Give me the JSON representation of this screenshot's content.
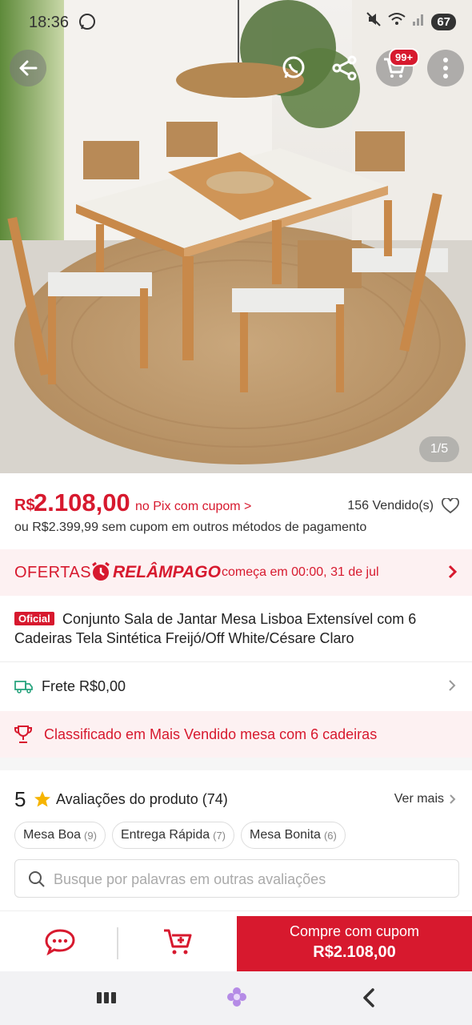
{
  "status_bar": {
    "time": "18:36",
    "battery": "67"
  },
  "header": {
    "cart_badge": "99+"
  },
  "gallery": {
    "counter": "1/5"
  },
  "price": {
    "currency": "R$",
    "value": "2.108,00",
    "pix_note": "no Pix com cupom >",
    "sold": "156 Vendido(s)",
    "alt_price": "ou R$2.399,99 sem cupom em outros métodos de pagamento"
  },
  "flash_sale": {
    "ofertas": "OFERTAS",
    "relampago": "RELÂMPAGO",
    "when": "começa em 00:00, 31 de jul"
  },
  "product": {
    "badge": "Oficial",
    "title": "Conjunto Sala de Jantar Mesa Lisboa Extensível com 6 Cadeiras Tela Sintética Freijó/Off White/Césare Claro"
  },
  "shipping": {
    "label": "Frete R$0,00"
  },
  "ranking": {
    "label": "Classificado em Mais Vendido mesa com 6 cadeiras"
  },
  "reviews": {
    "rating": "5",
    "label": "Avaliações do produto (74)",
    "see_more": "Ver mais",
    "chips": [
      {
        "label": "Mesa Boa",
        "count": "(9)"
      },
      {
        "label": "Entrega Rápida",
        "count": "(7)"
      },
      {
        "label": "Mesa Bonita",
        "count": "(6)"
      }
    ],
    "search_placeholder": "Busque por palavras em outras avaliações"
  },
  "action_bar": {
    "buy_line1": "Compre com cupom",
    "buy_line2": "R$2.108,00"
  },
  "colors": {
    "brand_red": "#d7192e",
    "soft_pink": "#fdf1f2",
    "wood": "#c8894a"
  },
  "icons": [
    "back-arrow-icon",
    "whatsapp-icon",
    "share-icon",
    "cart-icon",
    "more-vertical-icon",
    "heart-icon",
    "alarm-clock-icon",
    "truck-icon",
    "trophy-icon",
    "star-icon",
    "search-icon",
    "chat-icon",
    "add-to-cart-icon"
  ]
}
